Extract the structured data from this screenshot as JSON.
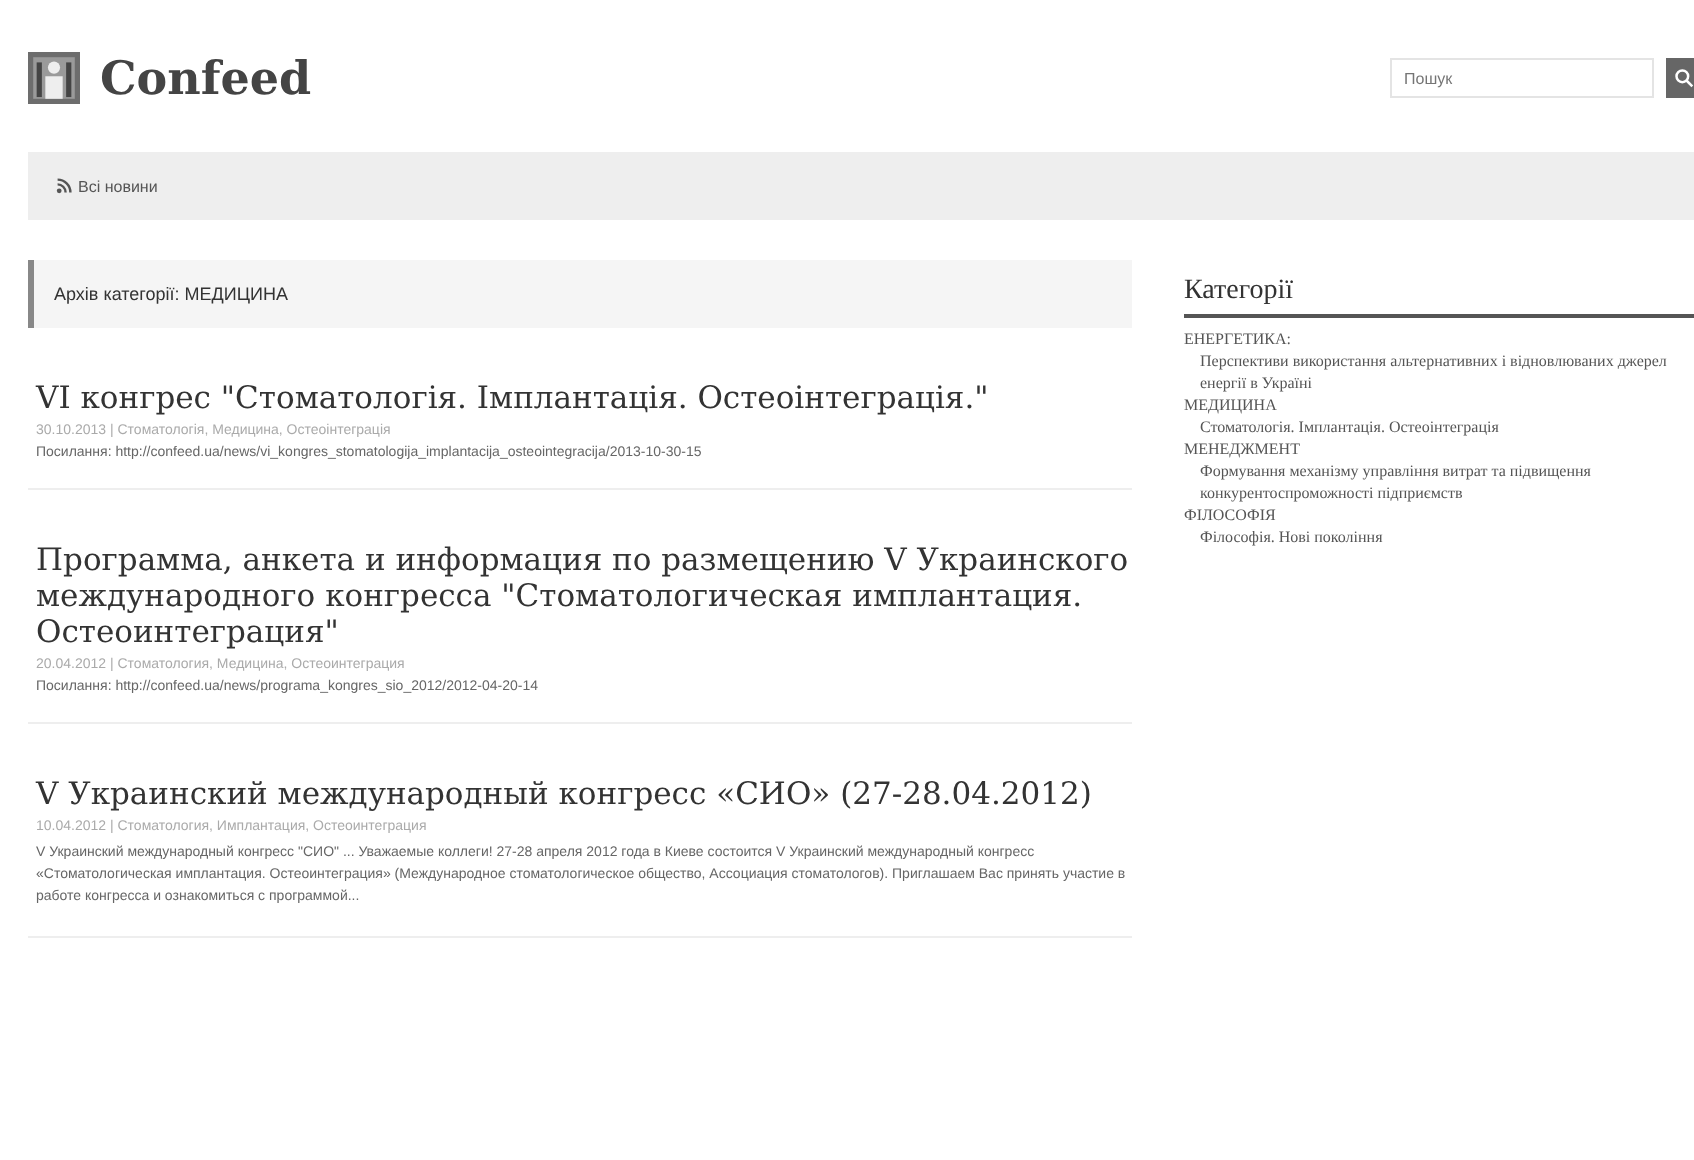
{
  "header": {
    "site_title": "Confeed",
    "search": {
      "placeholder": "Пошук"
    }
  },
  "nav": {
    "items": [
      {
        "label": "Всі новини"
      }
    ]
  },
  "archive_title": "Архів категорії: МЕДИЦИНА",
  "posts": [
    {
      "title": "VI конгрес \"Стоматологія. Імплантація. Остеоінтеграція.\"",
      "meta": "30.10.2013 | Стоматологія, Медицина, Остеоінтеграція",
      "link": "Посилання: http://confeed.ua/news/vi_kongres_stomatologija_implantacija_osteointegracija/2013-10-30-15"
    },
    {
      "title": "Программа, анкета и информация по размещению V Украинского международного конгресса \"Стоматологическая имплантация. Остеоинтеграция\"",
      "meta": "20.04.2012 | Стоматология, Медицина, Остеоинтеграция",
      "link": "Посилання: http://confeed.ua/news/programa_kongres_sio_2012/2012-04-20-14"
    },
    {
      "title": "V Украинский международный конгресс «СИО» (27-28.04.2012)",
      "meta": "10.04.2012 | Стоматология, Имплантация, Остеоинтеграция",
      "excerpt": "V Украинский международный конгресс \"СИО\"  ...  Уважаемые коллеги! 27-28 апреля 2012 года в Киеве состоится V Украинский международный конгресс «Стоматологическая имплантация. Остеоинтеграция» (Международное стоматологическое общество, Ассоциация стоматологов). Приглашаем Вас принять участие в работе конгресса и ознакомиться с программой..."
    }
  ],
  "sidebar": {
    "title": "Категорії",
    "items": [
      {
        "label": "ЕНЕРГЕТИКА:",
        "children": [
          {
            "label": "Перспективи використання альтернативних і відновлюваних джерел енергії в Україні"
          }
        ]
      },
      {
        "label": "МЕДИЦИНА",
        "children": [
          {
            "label": "Стоматологія. Імплантація. Остеоінтеграція"
          }
        ]
      },
      {
        "label": "МЕНЕДЖМЕНТ",
        "children": [
          {
            "label": "Формування механізму управління витрат та підвищення конкурентоспроможності підприємств"
          }
        ]
      },
      {
        "label": "ФІЛОСОФІЯ",
        "children": [
          {
            "label": "Філософія. Нові покоління"
          }
        ]
      }
    ]
  }
}
